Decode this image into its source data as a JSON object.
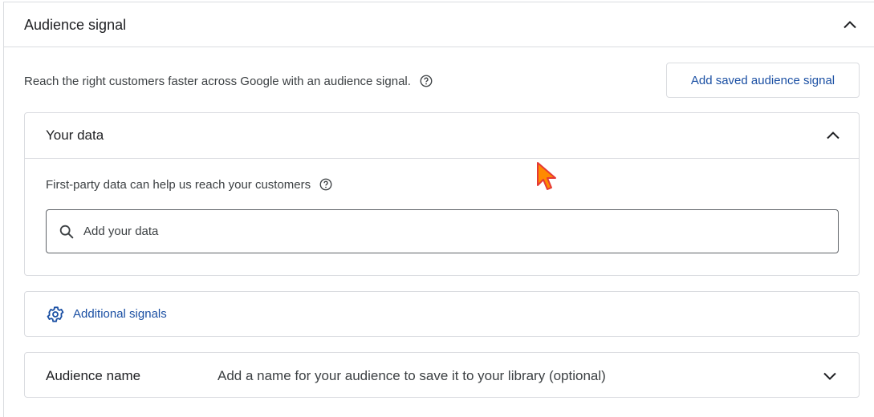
{
  "section": {
    "title": "Audience signal",
    "intro_text": "Reach the right customers faster across Google with an audience signal.",
    "saved_button_label": "Add saved audience signal"
  },
  "your_data": {
    "title": "Your data",
    "description": "First-party data can help us reach your customers",
    "search_placeholder": "Add your data",
    "search_value": ""
  },
  "additional_signals": {
    "label": "Additional signals"
  },
  "audience_name": {
    "label": "Audience name",
    "placeholder": "Add a name for your audience to save it to your library (optional)"
  },
  "icons": {
    "collapse": "chevron-up-icon",
    "expand": "chevron-down-icon",
    "help": "help-circle-icon",
    "search": "search-icon",
    "settings": "gear-icon",
    "cursor": "mouse-cursor-icon"
  },
  "colors": {
    "link": "#1a4fa3",
    "border": "#dadce0",
    "text": "#202124",
    "secondary_text": "#3c4043",
    "cursor_fill": "#ff8a00",
    "cursor_outline": "#e53935"
  }
}
